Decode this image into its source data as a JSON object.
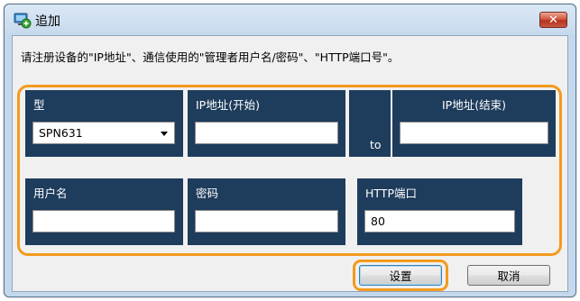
{
  "window": {
    "title": "追加",
    "close_symbol": "✕",
    "icons": {
      "app": "pc-add-icon",
      "close": "close-icon"
    }
  },
  "instruction": "请注册设备的\"IP地址\"、通信使用的\"管理者用户名/密码\"、\"HTTP端口号\"。",
  "form": {
    "model": {
      "label": "型",
      "value": "SPN631"
    },
    "ip_start": {
      "label": "IP地址(开始)",
      "value": ""
    },
    "to_label": "to",
    "ip_end": {
      "label": "IP地址(结束)",
      "value": ""
    },
    "username": {
      "label": "用户名",
      "value": ""
    },
    "password": {
      "label": "密码",
      "value": ""
    },
    "http_port": {
      "label": "HTTP端口",
      "value": "80"
    }
  },
  "buttons": {
    "ok": "设置",
    "cancel": "取消"
  },
  "colors": {
    "header_bg": "#1e3c5c",
    "highlight": "#f39a1e",
    "frame": "#c4d8ec",
    "close_button": "#c9553e"
  }
}
